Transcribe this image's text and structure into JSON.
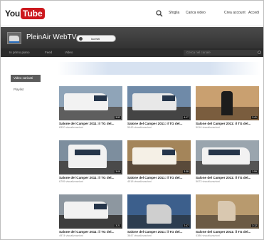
{
  "topbar": {
    "logo_you": "You",
    "logo_tube": "Tube",
    "links": [
      "Sfoglia",
      "Carica video",
      "Crea account",
      "Accedi"
    ]
  },
  "channel": {
    "title": "PleinAir WebTV",
    "subscribe_label": "Iscriviti"
  },
  "nav": {
    "items": [
      "In primo piano",
      "Feed",
      "Video"
    ],
    "search_placeholder": "Cerca nel canale"
  },
  "sidebar": {
    "active": "Video caricati",
    "items": [
      "Playlist"
    ]
  },
  "videos": [
    {
      "title": "Salone del Camper 2011: il TG del...",
      "meta": "8320 visualizzazioni"
    },
    {
      "title": "Salone del Camper 2011: il TG del...",
      "meta": "5943 visualizzazioni"
    },
    {
      "title": "Salone del Camper 2011: il TG del...",
      "meta": "5016 visualizzazioni"
    },
    {
      "title": "Salone del Camper 2011: il TG del...",
      "meta": "6795 visualizzazioni"
    },
    {
      "title": "Salone del Camper 2011: il TG del...",
      "meta": "4518 visualizzazioni"
    },
    {
      "title": "Salone del Camper 2011: il TG del...",
      "meta": "5673 visualizzazioni"
    },
    {
      "title": "Salone del Camper 2011: il TG del...",
      "meta": "4974 visualizzazioni"
    },
    {
      "title": "Salone del Camper 2011: il TG del...",
      "meta": "3847 visualizzazioni"
    },
    {
      "title": "Salone del Camper 2011: il TG del...",
      "meta": "4386 visualizzazioni"
    }
  ],
  "colors": {
    "brand": "#cc181e",
    "header_bg": "#3a3a3a",
    "nav_bg": "#2b2b2b"
  },
  "icons": [
    "search-icon"
  ]
}
